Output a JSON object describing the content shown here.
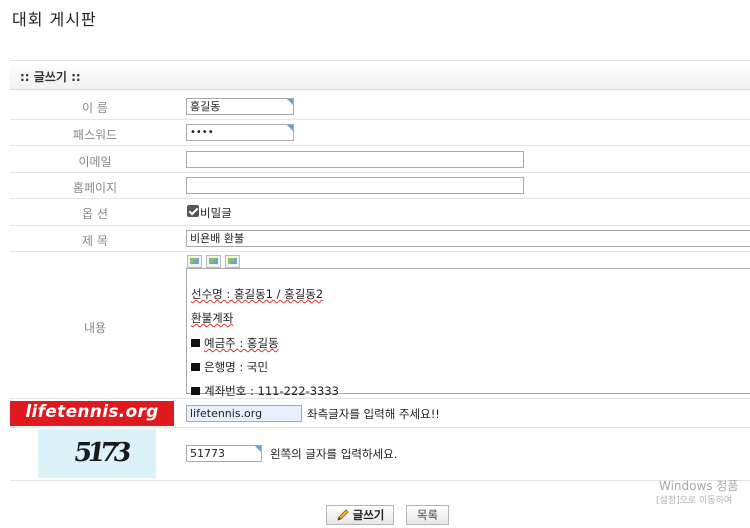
{
  "page": {
    "title": "대회 게시판"
  },
  "section": {
    "title": ":: 글쓰기 ::"
  },
  "form": {
    "name": {
      "label": "이 름",
      "value": "홍길동"
    },
    "password": {
      "label": "패스워드",
      "value": "••••"
    },
    "email": {
      "label": "이메일",
      "value": ""
    },
    "homepage": {
      "label": "홈페이지",
      "value": ""
    },
    "options": {
      "label": "옵 션",
      "secret_label": "비밀글",
      "secret_checked": true
    },
    "subject": {
      "label": "제 목",
      "value": "비욘배 환불"
    },
    "content": {
      "label": "내용",
      "lines": [
        {
          "prefix": "",
          "text": "선수명 : 홍길동1 / 홍길동2"
        },
        {
          "prefix": "",
          "text": "환불계좌"
        },
        {
          "prefix": "■ ",
          "text": "예금주 : 홍길동"
        },
        {
          "prefix": "■ ",
          "text": "은행명 : 국민"
        },
        {
          "prefix": "■ ",
          "text": "계좌번호 : 111-222-3333"
        }
      ]
    },
    "site_check": {
      "logo_text": "lifetennis.org",
      "value": "lifetennis.org",
      "hint": "좌측글자를 입력해 주세요!!"
    },
    "captcha": {
      "image_text": "5173",
      "value": "51773",
      "hint": "왼쪽의 글자를 입력하세요."
    }
  },
  "buttons": {
    "write": "글쓰기",
    "list": "목록"
  },
  "watermark": {
    "line1": "Windows 정품",
    "line2": "[설정]으로 이동하여"
  },
  "colors": {
    "logo_bg": "#e0191e",
    "captcha_bg": "#dbf3f8",
    "input_corner": "#6aa3d8"
  }
}
